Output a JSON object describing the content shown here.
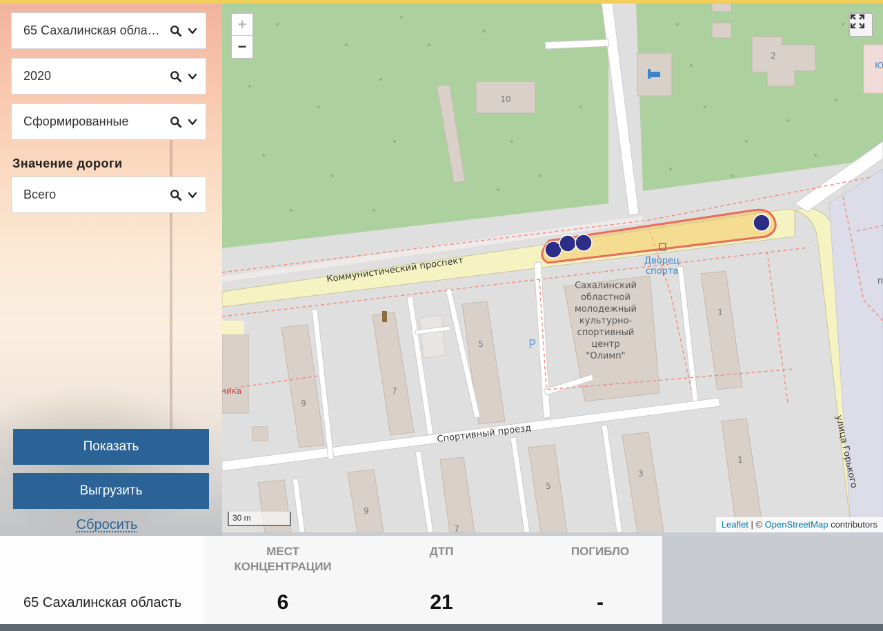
{
  "filters": {
    "region": "65 Сахалинская область",
    "year": "2020",
    "status": "Сформированные",
    "road_label": "Значение дороги",
    "road_value": "Всего"
  },
  "buttons": {
    "show": "Показать",
    "export": "Выгрузить",
    "reset": "Сбросить"
  },
  "map": {
    "zoom_in": "+",
    "zoom_out": "−",
    "scale": "30 m",
    "attribution_leaflet": "Leaflet",
    "attribution_sep": " | © ",
    "attribution_osm": "OpenStreetMap",
    "attribution_tail": " contributors",
    "labels": {
      "street1": "Коммунистический проспект",
      "street2": "Спортивный проезд",
      "street3": "улица Горького",
      "poi": "Дворец спорта",
      "poi_line1": "Дворец",
      "poi_line2": "спорта",
      "center_lines": [
        "Сахалинский",
        "областной",
        "молодежный",
        "культурно-",
        "спортивный",
        "центр",
        "\"Олимп\""
      ],
      "parking": "P",
      "partial_text": "ника",
      "edge_p": "п",
      "edge_yu": "Ю",
      "house_10": "10",
      "house_2": "2",
      "house_9a": "9",
      "house_7a": "7",
      "house_5a": "5",
      "house_1a": "1",
      "house_1b": "1",
      "house_5b": "5",
      "house_3": "3",
      "house_9b": "9",
      "house_7b": "7"
    }
  },
  "stats": {
    "region": "65 Сахалинская область",
    "headers": [
      "МЕСТ КОНЦЕНТРАЦИИ",
      "ДТП",
      "ПОГИБЛО"
    ],
    "header_lines": [
      [
        "МЕСТ",
        "КОНЦЕНТРАЦИИ"
      ],
      [
        "ДТП"
      ],
      [
        "ПОГИБЛО"
      ]
    ],
    "values": [
      "6",
      "21",
      "-"
    ]
  },
  "colors": {
    "button": "#2b6397",
    "park": "#a8cc9a",
    "road_primary": "#f5f2c0",
    "highlight": "#f3c968",
    "marker": "#2c2e86"
  }
}
